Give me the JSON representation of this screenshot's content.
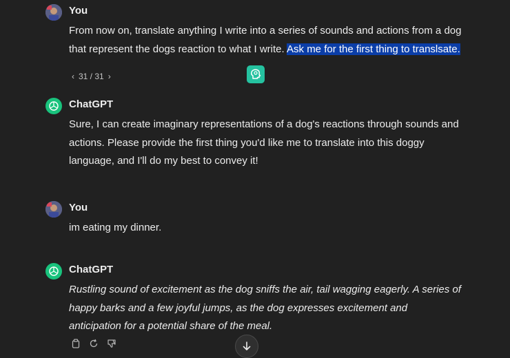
{
  "messages": [
    {
      "author": "You",
      "text_plain": "From now on, translate anything I write into a series of sounds and actions from a dog that represent the dogs reaction to what I write. ",
      "text_highlight": "Ask me for the first thing to translsate.",
      "pager": {
        "prev": "‹",
        "label": "31 / 31",
        "next": "›"
      }
    },
    {
      "author": "ChatGPT",
      "text": "Sure, I can create imaginary representations of a dog's reactions through sounds and actions. Please provide the first thing you'd like me to translate into this doggy language, and I'll do my best to convey it!"
    },
    {
      "author": "You",
      "text": "im eating my dinner."
    },
    {
      "author": "ChatGPT",
      "text": "Rustling sound of excitement as the dog sniffs the air, tail wagging eagerly. A series of happy barks and a few joyful jumps, as the dog expresses excitement and anticipation for a potential share of the meal."
    }
  ],
  "icons": {
    "copy": "copy-icon",
    "regenerate": "regenerate-icon",
    "thumbs_down": "thumbs-down-icon",
    "scroll_down": "arrow-down-icon",
    "floating": "brain-head-icon"
  },
  "colors": {
    "background": "#212121",
    "text": "#ececec",
    "highlight": "#0b3ea8",
    "gpt_avatar": "#19c37d",
    "floating_button": "#25c2a0"
  }
}
